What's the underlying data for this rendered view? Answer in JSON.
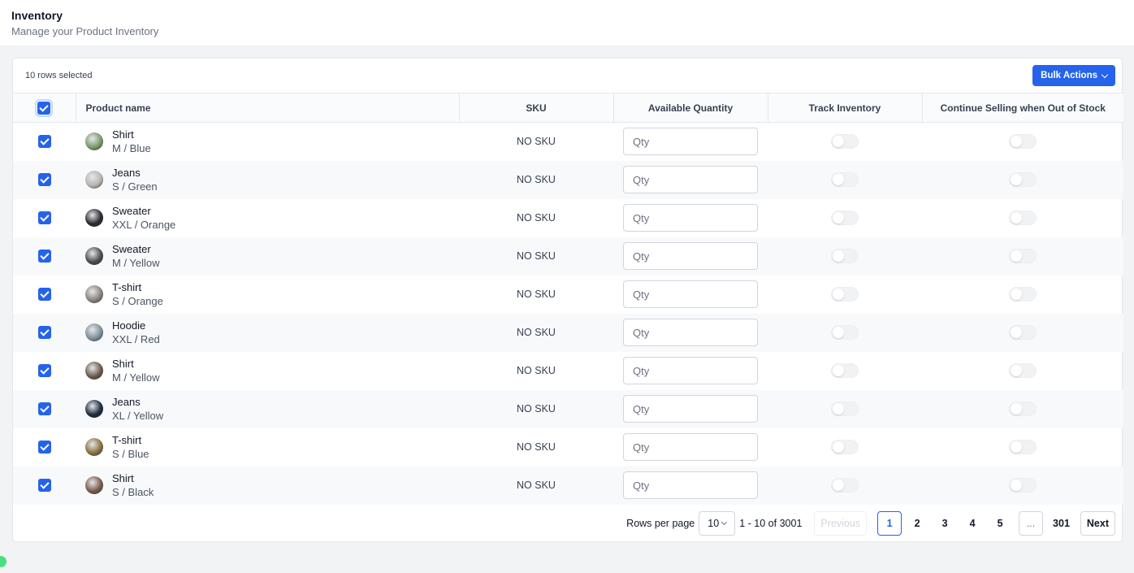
{
  "header": {
    "title": "Inventory",
    "subtitle": "Manage your Product Inventory"
  },
  "toolbar": {
    "selected_text": "10 rows selected",
    "bulk_actions_label": "Bulk Actions"
  },
  "table": {
    "columns": {
      "product": "Product name",
      "sku": "SKU",
      "qty": "Available Quantity",
      "track": "Track Inventory",
      "continue": "Continue Selling when Out of Stock"
    },
    "qty_placeholder": "Qty",
    "rows": [
      {
        "name": "Shirt",
        "variant": "M / Blue",
        "sku": "NO SKU",
        "checked": true,
        "track": false,
        "continue": false,
        "thumb_color": "#7a9a6a"
      },
      {
        "name": "Jeans",
        "variant": "S / Green",
        "sku": "NO SKU",
        "checked": true,
        "track": false,
        "continue": false,
        "thumb_color": "#b8b4b0"
      },
      {
        "name": "Sweater",
        "variant": "XXL / Orange",
        "sku": "NO SKU",
        "checked": true,
        "track": false,
        "continue": false,
        "thumb_color": "#2a2a2e"
      },
      {
        "name": "Sweater",
        "variant": "M / Yellow",
        "sku": "NO SKU",
        "checked": true,
        "track": false,
        "continue": false,
        "thumb_color": "#4a4c50"
      },
      {
        "name": "T-shirt",
        "variant": "S / Orange",
        "sku": "NO SKU",
        "checked": true,
        "track": false,
        "continue": false,
        "thumb_color": "#8a8478"
      },
      {
        "name": "Hoodie",
        "variant": "XXL / Red",
        "sku": "NO SKU",
        "checked": true,
        "track": false,
        "continue": false,
        "thumb_color": "#7f8f98"
      },
      {
        "name": "Shirt",
        "variant": "M / Yellow",
        "sku": "NO SKU",
        "checked": true,
        "track": false,
        "continue": false,
        "thumb_color": "#6a5a4a"
      },
      {
        "name": "Jeans",
        "variant": "XL / Yellow",
        "sku": "NO SKU",
        "checked": true,
        "track": false,
        "continue": false,
        "thumb_color": "#1e2a3a"
      },
      {
        "name": "T-shirt",
        "variant": "S / Blue",
        "sku": "NO SKU",
        "checked": true,
        "track": false,
        "continue": false,
        "thumb_color": "#8a7040"
      },
      {
        "name": "Shirt",
        "variant": "S / Black",
        "sku": "NO SKU",
        "checked": true,
        "track": false,
        "continue": false,
        "thumb_color": "#7a5a48"
      }
    ]
  },
  "pagination": {
    "rows_per_page_label": "Rows per page",
    "rows_per_page": "10",
    "range_text": "1 - 10 of 3001",
    "previous_label": "Previous",
    "next_label": "Next",
    "pages": [
      "1",
      "2",
      "3",
      "4",
      "5"
    ],
    "ellipsis": "...",
    "last_page": "301",
    "current_page": "1"
  },
  "colors": {
    "accent": "#2563eb",
    "status_dot": "#4ade80"
  }
}
